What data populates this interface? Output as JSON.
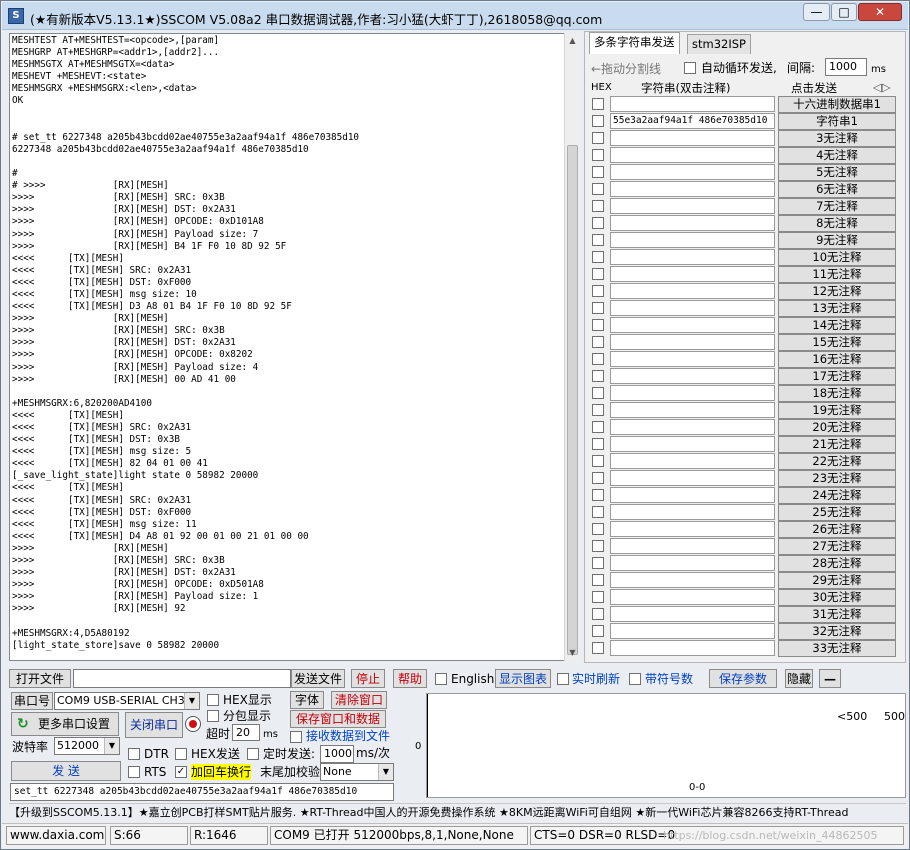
{
  "window": {
    "title": "(★有新版本V5.13.1★)SSCOM V5.08a2 串口数据调试器,作者:习小猛(大虾丁丁),2618058@qq.com",
    "min_btn": "—",
    "max_btn": "□",
    "close_btn": "✕"
  },
  "log": {
    "text": "MESHTEST AT+MESHTEST=<opcode>,[param]\nMESHGRP AT+MESHGRP=<addr1>,[addr2]...\nMESHMSGTX AT+MESHMSGTX=<data>\nMESHEVT +MESHEVT:<state>\nMESHMSGRX +MESHMSGRX:<len>,<data>\nOK\n\n\n# set_tt 6227348 a205b43bcdd02ae40755e3a2aaf94a1f 486e70385d10\n6227348 a205b43bcdd02ae40755e3a2aaf94a1f 486e70385d10\n\n#\n# >>>>            [RX][MESH]\n>>>>              [RX][MESH] SRC: 0x3B\n>>>>              [RX][MESH] DST: 0x2A31\n>>>>              [RX][MESH] OPCODE: 0xD101A8\n>>>>              [RX][MESH] Payload size: 7\n>>>>              [RX][MESH] B4 1F F0 10 8D 92 5F\n<<<<      [TX][MESH]\n<<<<      [TX][MESH] SRC: 0x2A31\n<<<<      [TX][MESH] DST: 0xF000\n<<<<      [TX][MESH] msg size: 10\n<<<<      [TX][MESH] D3 A8 01 B4 1F F0 10 8D 92 5F\n>>>>              [RX][MESH]\n>>>>              [RX][MESH] SRC: 0x3B\n>>>>              [RX][MESH] DST: 0x2A31\n>>>>              [RX][MESH] OPCODE: 0x8202\n>>>>              [RX][MESH] Payload size: 4\n>>>>              [RX][MESH] 00 AD 41 00\n\n+MESHMSGRX:6,820200AD4100\n<<<<      [TX][MESH]\n<<<<      [TX][MESH] SRC: 0x2A31\n<<<<      [TX][MESH] DST: 0x3B\n<<<<      [TX][MESH] msg size: 5\n<<<<      [TX][MESH] 82 04 01 00 41\n[_save_light_state]light state 0 58982 20000\n<<<<      [TX][MESH]\n<<<<      [TX][MESH] SRC: 0x2A31\n<<<<      [TX][MESH] DST: 0xF000\n<<<<      [TX][MESH] msg size: 11\n<<<<      [TX][MESH] D4 A8 01 92 00 01 00 21 01 00 00\n>>>>              [RX][MESH]\n>>>>              [RX][MESH] SRC: 0x3B\n>>>>              [RX][MESH] DST: 0x2A31\n>>>>              [RX][MESH] OPCODE: 0xD501A8\n>>>>              [RX][MESH] Payload size: 1\n>>>>              [RX][MESH] 92\n\n+MESHMSGRX:4,D5A80192\n[light_state_store]save 0 58982 20000"
  },
  "right_panel": {
    "tab_multi": "多条字符串发送",
    "tab_isp": "stm32ISP",
    "divider_label": "←拖动分割线",
    "auto_loop_label": "自动循环发送,",
    "interval_label": "间隔:",
    "interval_value": "1000",
    "interval_unit": "ms",
    "hdr_hex": "HEX",
    "hdr_string": "字符串(双击注释)",
    "hdr_send": "点击发送",
    "hdr_scroll_icon": "◁▷",
    "rows": [
      {
        "value": "",
        "button": "十六进制数据串1"
      },
      {
        "value": "55e3a2aaf94a1f 486e70385d10",
        "button": "字符串1"
      },
      {
        "value": "",
        "button": "3无注释"
      },
      {
        "value": "",
        "button": "4无注释"
      },
      {
        "value": "",
        "button": "5无注释"
      },
      {
        "value": "",
        "button": "6无注释"
      },
      {
        "value": "",
        "button": "7无注释"
      },
      {
        "value": "",
        "button": "8无注释"
      },
      {
        "value": "",
        "button": "9无注释"
      },
      {
        "value": "",
        "button": "10无注释"
      },
      {
        "value": "",
        "button": "11无注释"
      },
      {
        "value": "",
        "button": "12无注释"
      },
      {
        "value": "",
        "button": "13无注释"
      },
      {
        "value": "",
        "button": "14无注释"
      },
      {
        "value": "",
        "button": "15无注释"
      },
      {
        "value": "",
        "button": "16无注释"
      },
      {
        "value": "",
        "button": "17无注释"
      },
      {
        "value": "",
        "button": "18无注释"
      },
      {
        "value": "",
        "button": "19无注释"
      },
      {
        "value": "",
        "button": "20无注释"
      },
      {
        "value": "",
        "button": "21无注释"
      },
      {
        "value": "",
        "button": "22无注释"
      },
      {
        "value": "",
        "button": "23无注释"
      },
      {
        "value": "",
        "button": "24无注释"
      },
      {
        "value": "",
        "button": "25无注释"
      },
      {
        "value": "",
        "button": "26无注释"
      },
      {
        "value": "",
        "button": "27无注释"
      },
      {
        "value": "",
        "button": "28无注释"
      },
      {
        "value": "",
        "button": "29无注释"
      },
      {
        "value": "",
        "button": "30无注释"
      },
      {
        "value": "",
        "button": "31无注释"
      },
      {
        "value": "",
        "button": "32无注释"
      },
      {
        "value": "",
        "button": "33无注释"
      }
    ]
  },
  "toolbar": {
    "open_file": "打开文件",
    "send_file": "发送文件",
    "stop": "停止",
    "help": "帮助",
    "english": "English",
    "show_chart": "显示图表",
    "realtime_refresh": "实时刷新",
    "with_seq": "带符号数",
    "save_params": "保存参数",
    "hide": "隐藏",
    "dash": "—"
  },
  "serial": {
    "port_label": "串口号",
    "port_value": "COM9 USB-SERIAL CH340",
    "more_settings": "更多串口设置",
    "close_port": "关闭串口",
    "baud_label": "波特率",
    "baud_value": "512000",
    "hex_display": "HEX显示",
    "packet_display": "分包显示",
    "timeout_label": "超时",
    "timeout_value": "20",
    "timeout_unit": "ms",
    "font_btn": "字体",
    "clear_window": "清除窗口",
    "save_window": "保存窗口和数据",
    "recv_to_file": "接收数据到文件",
    "dtr": "DTR",
    "rts": "RTS",
    "hex_send": "HEX发送",
    "timed_send": "定时发送:",
    "timed_value": "1000",
    "timed_unit": "ms/次",
    "add_crlf": "加回车换行",
    "checksum_label": "末尾加校验",
    "checksum_value": "None",
    "send_btn": "发 送",
    "send_input": "set_tt 6227348 a205b43bcdd02ae40755e3a2aaf94a1f 486e70385d10"
  },
  "chart": {
    "y_zero": "0",
    "label_lt500": "<500",
    "label_500": "500",
    "bottom_label": "0-0"
  },
  "banner": "【升级到SSCOM5.13.1】★嘉立创PCB打样SMT贴片服务. ★RT-Thread中国人的开源免费操作系统 ★8KM远距离WiFi可自组网 ★新一代WiFi芯片兼容8266支持RT-Thread",
  "status": {
    "site": "www.daxia.com",
    "s": "S:66",
    "r": "R:1646",
    "port_state": "COM9 已打开  512000bps,8,1,None,None",
    "lines": "CTS=0 DSR=0 RLSD=0",
    "watermark": "https://blog.csdn.net/weixin_44862505"
  },
  "colors": {
    "title_bar": "#c9dbee",
    "close_btn": "#c9473c",
    "red_text": "#c0000a",
    "blue_text": "#003fbf",
    "highlight_yellow": "#ffff00"
  }
}
